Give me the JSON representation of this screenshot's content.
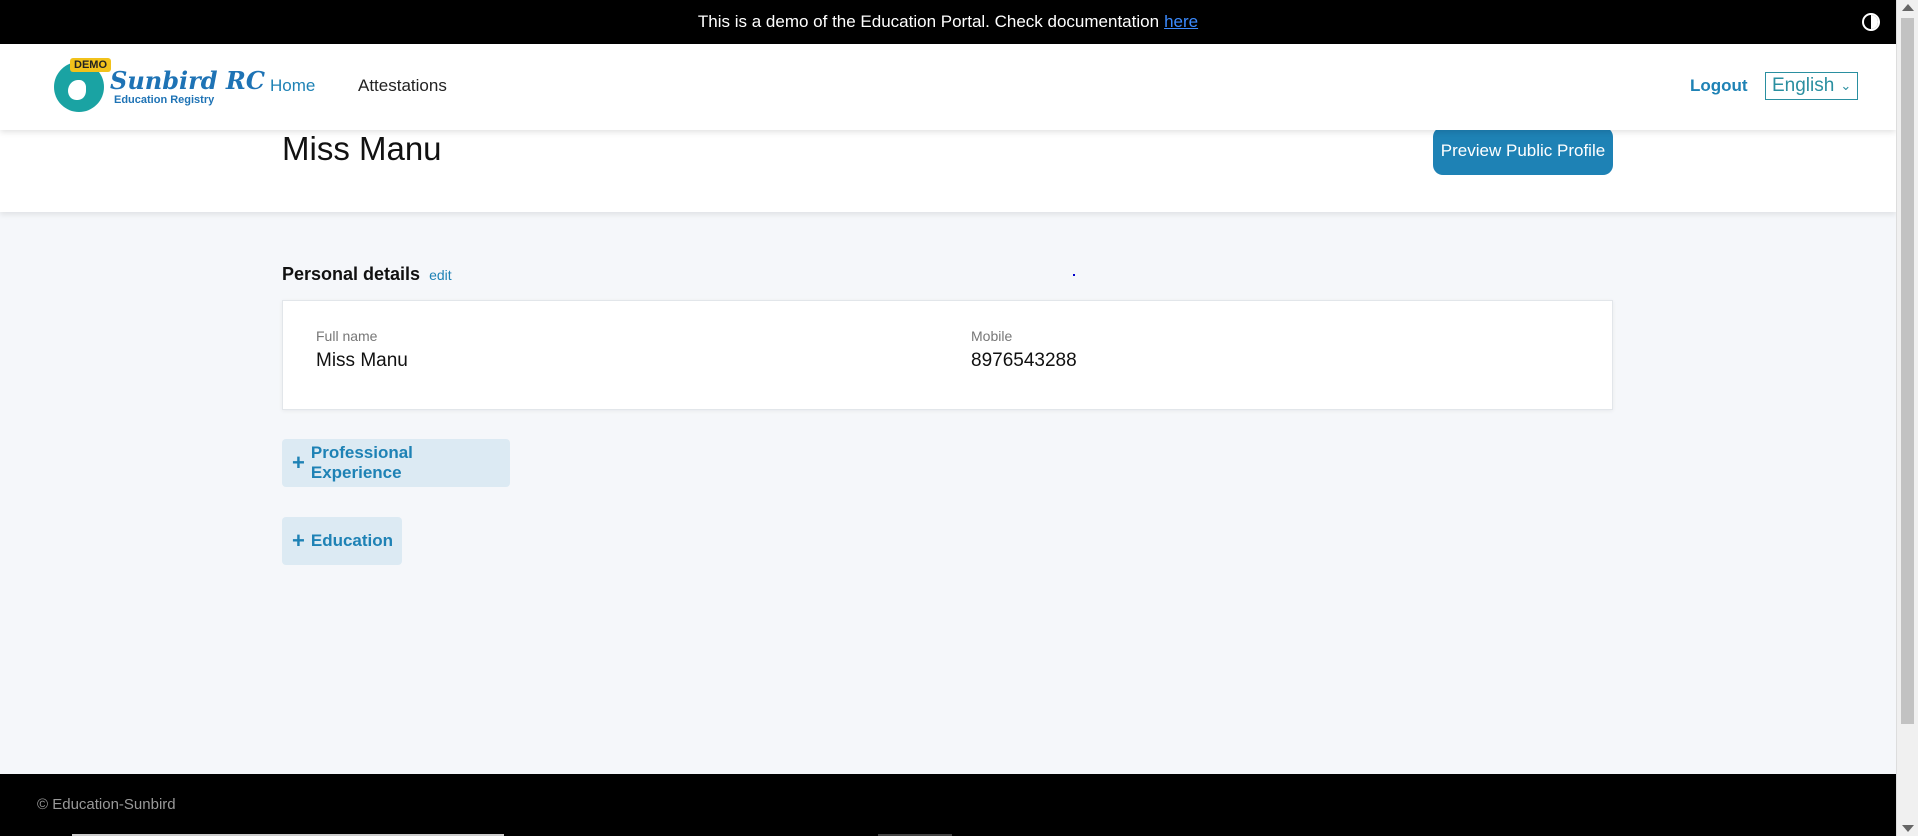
{
  "banner": {
    "text": "This is a demo of the Education Portal. Check documentation",
    "link_label": "here",
    "contrast_icon": "contrast-icon"
  },
  "logo": {
    "badge": "DEMO",
    "title": "Sunbird RC",
    "subtitle": "Education Registry"
  },
  "nav": {
    "home": "Home",
    "attestations": "Attestations",
    "logout": "Logout",
    "language": "English"
  },
  "profile": {
    "name": "Miss Manu",
    "preview_button": "Preview Public Profile"
  },
  "personal_details": {
    "title": "Personal details",
    "edit_label": "edit",
    "fields": [
      {
        "label": "Full name",
        "value": "Miss Manu"
      },
      {
        "label": "Mobile",
        "value": "8976543288"
      }
    ]
  },
  "sections": [
    {
      "label": "Professional Experience"
    },
    {
      "label": "Education"
    }
  ],
  "footer": {
    "text": "© Education-Sunbird"
  },
  "colors": {
    "accent": "#1e82b5",
    "banner_bg": "#000000",
    "page_bg": "#f5f7fa"
  }
}
